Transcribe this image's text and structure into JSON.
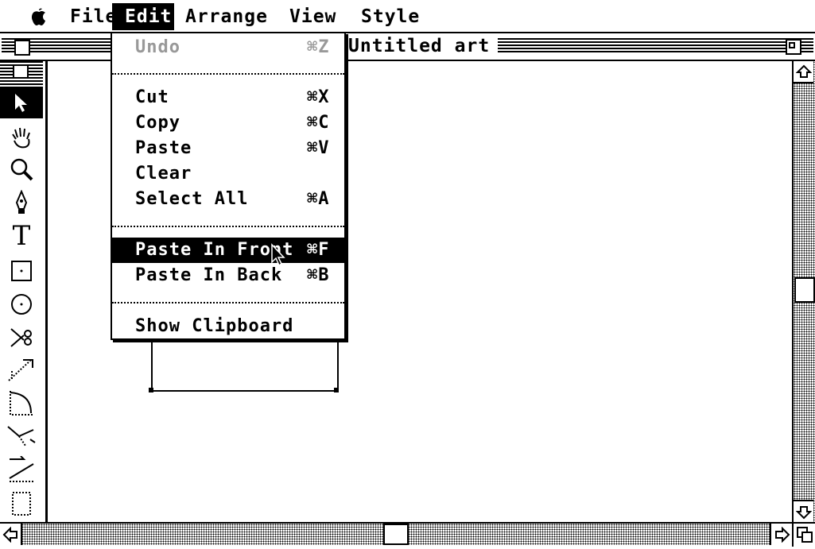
{
  "menubar": {
    "apple_icon": "apple-icon",
    "items": [
      {
        "label": "File",
        "active": false
      },
      {
        "label": "Edit",
        "active": true
      },
      {
        "label": "Arrange",
        "active": false
      },
      {
        "label": "View",
        "active": false
      },
      {
        "label": "Style",
        "active": false
      }
    ]
  },
  "window": {
    "title": "Untitled art"
  },
  "edit_menu": {
    "items": [
      {
        "label": "Undo",
        "shortcut": "⌘Z",
        "enabled": false
      },
      {
        "label": "Cut",
        "shortcut": "⌘X",
        "enabled": true
      },
      {
        "label": "Copy",
        "shortcut": "⌘C",
        "enabled": true
      },
      {
        "label": "Paste",
        "shortcut": "⌘V",
        "enabled": true
      },
      {
        "label": "Clear",
        "shortcut": "",
        "enabled": true
      },
      {
        "label": "Select All",
        "shortcut": "⌘A",
        "enabled": true
      },
      {
        "label": "Paste In Front",
        "shortcut": "⌘F",
        "enabled": true,
        "highlighted": true
      },
      {
        "label": "Paste In Back",
        "shortcut": "⌘B",
        "enabled": true
      },
      {
        "label": "Show Clipboard",
        "shortcut": "",
        "enabled": true
      }
    ]
  },
  "tools": [
    "arrow-tool-icon",
    "grabber-hand-icon",
    "zoom-magnifier-icon",
    "pen-tool-icon",
    "text-tool-icon",
    "rectangle-tool-icon",
    "oval-tool-icon",
    "scissors-tool-icon",
    "blend-tool-icon",
    "arc-tool-icon",
    "rotate-tool-icon",
    "reflect-tool-icon",
    "scale-tool-icon"
  ]
}
